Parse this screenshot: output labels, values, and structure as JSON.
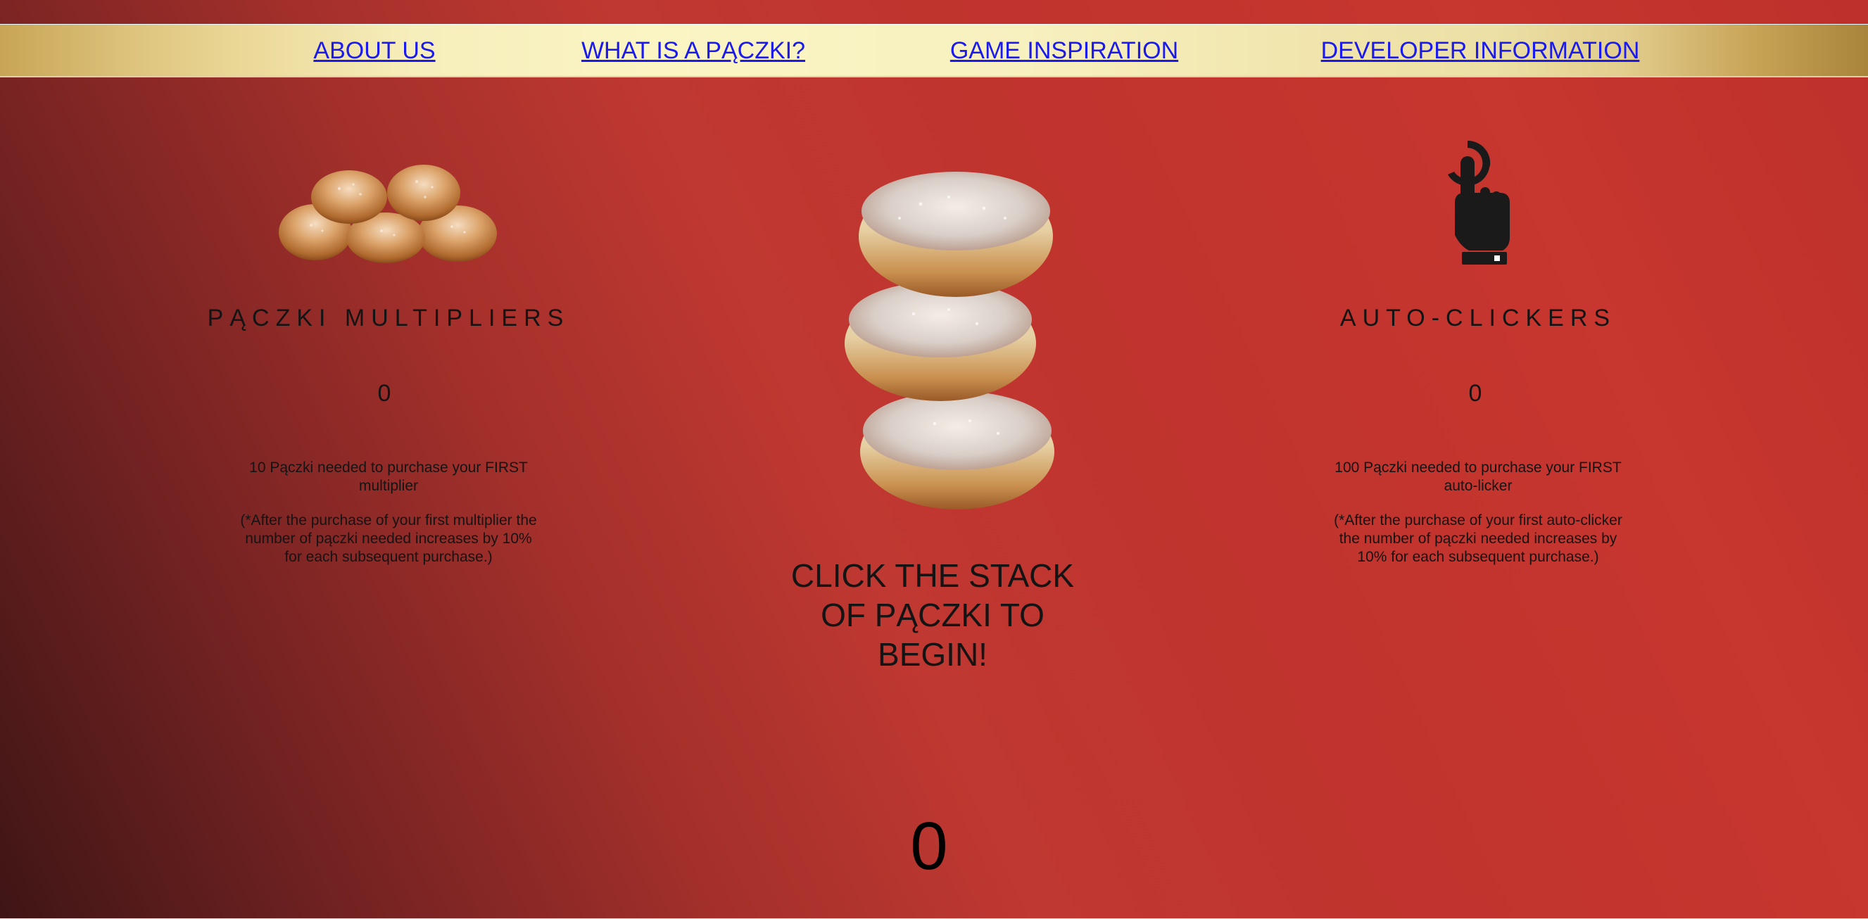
{
  "nav": {
    "about": "ABOUT US",
    "what": "WHAT IS A PĄCZKI?",
    "inspiration": "GAME INSPIRATION",
    "developer": "DEVELOPER INFORMATION"
  },
  "multipliers": {
    "title": "PĄCZKI MULTIPLIERS",
    "count": "0",
    "requirement": "10 Pączki needed to purchase your FIRST multiplier",
    "note": "(*After the purchase of your first multiplier the number of pączki needed increases by 10% for each subsequent purchase.)",
    "image_icon": "paczki-pile-image"
  },
  "autoclickers": {
    "title": "AUTO-CLICKERS",
    "count": "0",
    "requirement": "100 Pączki needed to purchase your FIRST auto-licker",
    "note": "(*After the purchase of your first auto-clicker the number of pączki needed increases by 10% for each subsequent purchase.)",
    "image_icon": "pointing-hand-icon"
  },
  "main": {
    "prompt": "CLICK THE STACK OF PĄCZKI TO BEGIN!",
    "total": "0",
    "image_icon": "paczki-stack-image"
  },
  "colors": {
    "nav_gold": "#fbf5c4",
    "link_blue": "#1a1aea",
    "background_red": "#c0332e",
    "text_dark": "#141414"
  }
}
